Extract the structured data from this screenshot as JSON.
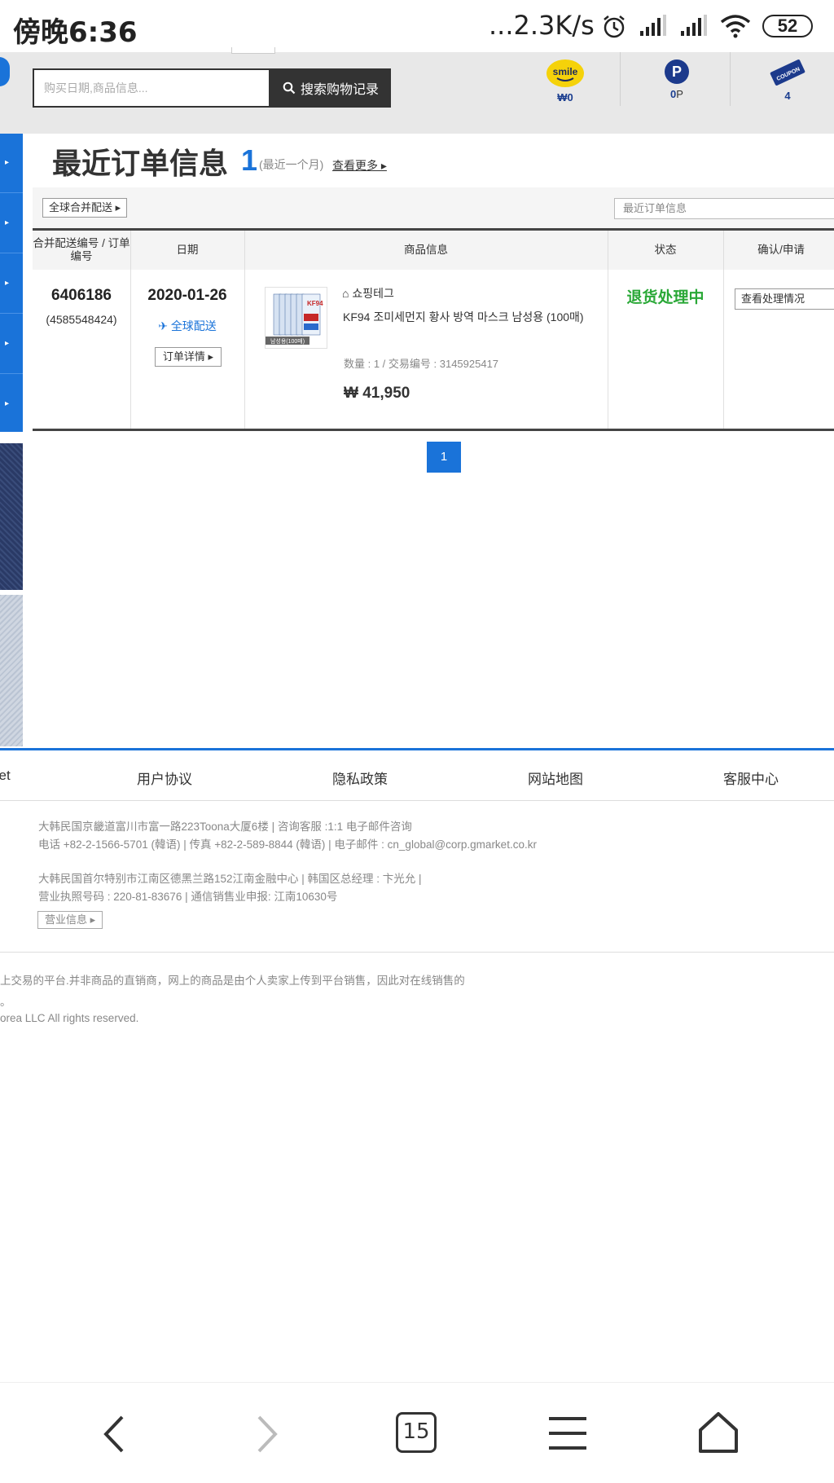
{
  "status_bar": {
    "time": "傍晚6:36",
    "speed": "...2.3K/s",
    "battery": "52"
  },
  "header": {
    "search_placeholder": "购买日期,商品信息...",
    "search_button": "搜索购物记录",
    "smile_logo": "smile",
    "smile_value": "₩0",
    "point_value": "0",
    "point_unit": "P",
    "coupon_label": "COUPON",
    "coupon_count": "4"
  },
  "title": {
    "main": "最近订单信息",
    "count": "1",
    "period": "(最近一个月)",
    "see_more": "查看更多"
  },
  "filter": {
    "global_combine": "全球合并配送",
    "recent_select": "最近订单信息"
  },
  "table": {
    "headers": [
      "合并配送编号 / 订单编号",
      "日期",
      "商品信息",
      "状态",
      "确认/申请"
    ],
    "row": {
      "order_number": "6406186",
      "order_sub": "(4585548424)",
      "date": "2020-01-26",
      "global_ship": "全球配送",
      "order_detail": "订单详情",
      "thumb_label": "남성용(100매)",
      "thumb_text": "KF94",
      "seller": "쇼핑테그",
      "product_name": "KF94 조미세먼지 황사 방역 마스크 남성용 (100매)",
      "meta": "数量 : 1 / 交易编号 : 3145925417",
      "price": "₩ 41,950",
      "status": "退货处理中",
      "action": "查看处理情况"
    }
  },
  "pagination": {
    "current": "1"
  },
  "footer": {
    "links": [
      "ket",
      "用户协议",
      "隐私政策",
      "网站地图",
      "客服中心"
    ],
    "address1_line1": "大韩民国京畿道富川市富一路223Toona大厦6楼 | 咨询客服 :1:1 电子邮件咨询",
    "address1_line2": "电话 +82-2-1566-5701 (韓语) | 传真 +82-2-589-8844 (韓语) | 电子邮件 : cn_global@corp.gmarket.co.kr",
    "address2_line1": "大韩民国首尔特别市江南区德黑兰路152江南金融中心 | 韩国区总经理 : 卞光允 |",
    "address2_line2": "营业执照号码 : 220-81-83676 | 通信销售业申报: 江南10630号",
    "business_info": "营业信息",
    "disclaimer1": "上交易的平台.并非商品的直销商，网上的商品是由个人卖家上传到平台销售，因此对在线销售的",
    "disclaimer2": "。",
    "disclaimer3": "orea LLC All rights reserved."
  },
  "navbar": {
    "tab_count": "15"
  },
  "colors": {
    "accent": "#1a73d9",
    "status_green": "#2aa837",
    "header_bg": "#e8e8e8"
  }
}
